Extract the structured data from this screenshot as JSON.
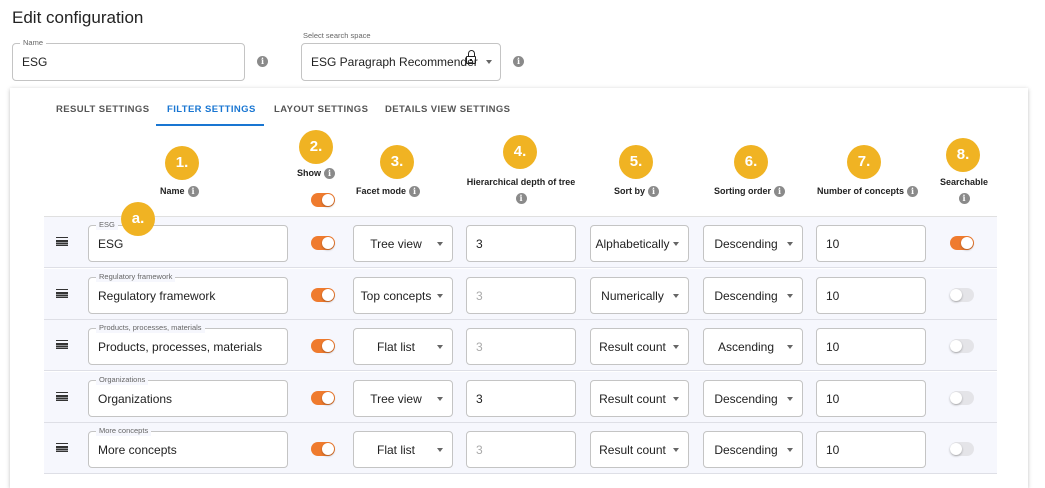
{
  "title": "Edit configuration",
  "name_field": {
    "label": "Name",
    "value": "ESG"
  },
  "search_space": {
    "label": "Select search space",
    "value": "ESG Paragraph Recommender"
  },
  "tabs": [
    {
      "label": "RESULT SETTINGS"
    },
    {
      "label": "FILTER SETTINGS",
      "active": true
    },
    {
      "label": "LAYOUT SETTINGS"
    },
    {
      "label": "DETAILS VIEW SETTINGS"
    }
  ],
  "columns": {
    "name": "Name",
    "show": "Show",
    "facet_mode": "Facet mode",
    "depth": "Hierarchical depth of tree",
    "sort_by": "Sort by",
    "sorting_order": "Sorting order",
    "number": "Number of concepts",
    "searchable": "Searchable"
  },
  "show_all": true,
  "badges": [
    "1.",
    "2.",
    "3.",
    "4.",
    "5.",
    "6.",
    "7.",
    "8.",
    "a."
  ],
  "accent": "#ef7b2e",
  "badge_color": "#f0b323",
  "tab_color": "#1976d2",
  "rows": [
    {
      "label": "ESG",
      "name": "ESG",
      "show": true,
      "facet_mode": "Tree view",
      "depth": "3",
      "depth_enabled": true,
      "sort_by": "Alphabetically",
      "order": "Descending",
      "number": "10",
      "searchable": true
    },
    {
      "label": "Regulatory framework",
      "name": "Regulatory framework",
      "show": true,
      "facet_mode": "Top concepts",
      "depth": "3",
      "depth_enabled": false,
      "sort_by": "Numerically",
      "order": "Descending",
      "number": "10",
      "searchable": false
    },
    {
      "label": "Products, processes, materials",
      "name": "Products, processes, materials",
      "show": true,
      "facet_mode": "Flat list",
      "depth": "3",
      "depth_enabled": false,
      "sort_by": "Result count",
      "order": "Ascending",
      "number": "10",
      "searchable": false
    },
    {
      "label": "Organizations",
      "name": "Organizations",
      "show": true,
      "facet_mode": "Tree view",
      "depth": "3",
      "depth_enabled": true,
      "sort_by": "Result count",
      "order": "Descending",
      "number": "10",
      "searchable": false
    },
    {
      "label": "More concepts",
      "name": "More concepts",
      "show": true,
      "facet_mode": "Flat list",
      "depth": "3",
      "depth_enabled": false,
      "sort_by": "Result count",
      "order": "Descending",
      "number": "10",
      "searchable": false
    }
  ]
}
